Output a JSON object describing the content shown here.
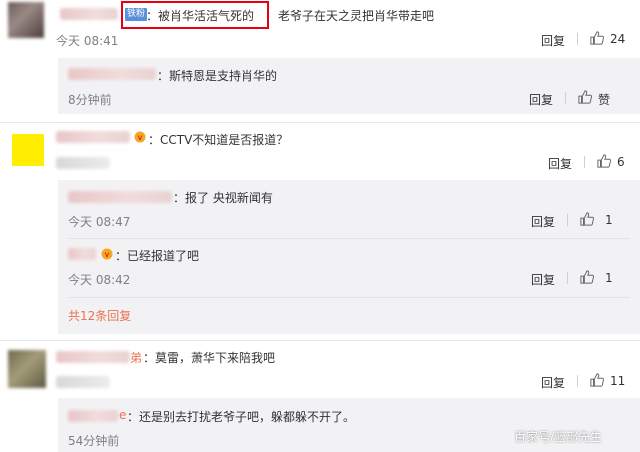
{
  "comment1": {
    "fan_badge": "铁粉",
    "text_highlighted": "：被肖华活活气死的",
    "text_rest": "老爷子在天之灵把肖华带走吧",
    "time": "今天 08:41",
    "reply_label": "回复",
    "likes": "24",
    "highlight_color": "#e60012",
    "replies": [
      {
        "text": "：斯特恩是支持肖华的",
        "time": "8分钟前",
        "reply_label": "回复",
        "likes": "赞"
      }
    ]
  },
  "comment2": {
    "text": "：CCTV不知道是否报道？",
    "reply_label": "回复",
    "likes": "6",
    "avatar_color": "#ffee00",
    "replies": [
      {
        "text": "：报了 央视新闻有",
        "time": "今天 08:47",
        "reply_label": "回复",
        "likes": "1"
      },
      {
        "text": "：已经报道了吧",
        "time": "今天 08:42",
        "reply_label": "回复",
        "likes": "1"
      }
    ],
    "more_replies": "共12条回复"
  },
  "comment3": {
    "name_suffix": "弟",
    "text": "：莫雷，萧华下来陪我吧",
    "reply_label": "回复",
    "likes": "11",
    "replies": [
      {
        "name_suffix": "e",
        "text": "：还是别去打扰老爷子吧，躲都躲不开了。",
        "time": "54分钟前"
      }
    ]
  },
  "watermark": "百家号/篮部先生",
  "colors": {
    "link": "#eb7350",
    "badge": "#5b8fd9"
  }
}
